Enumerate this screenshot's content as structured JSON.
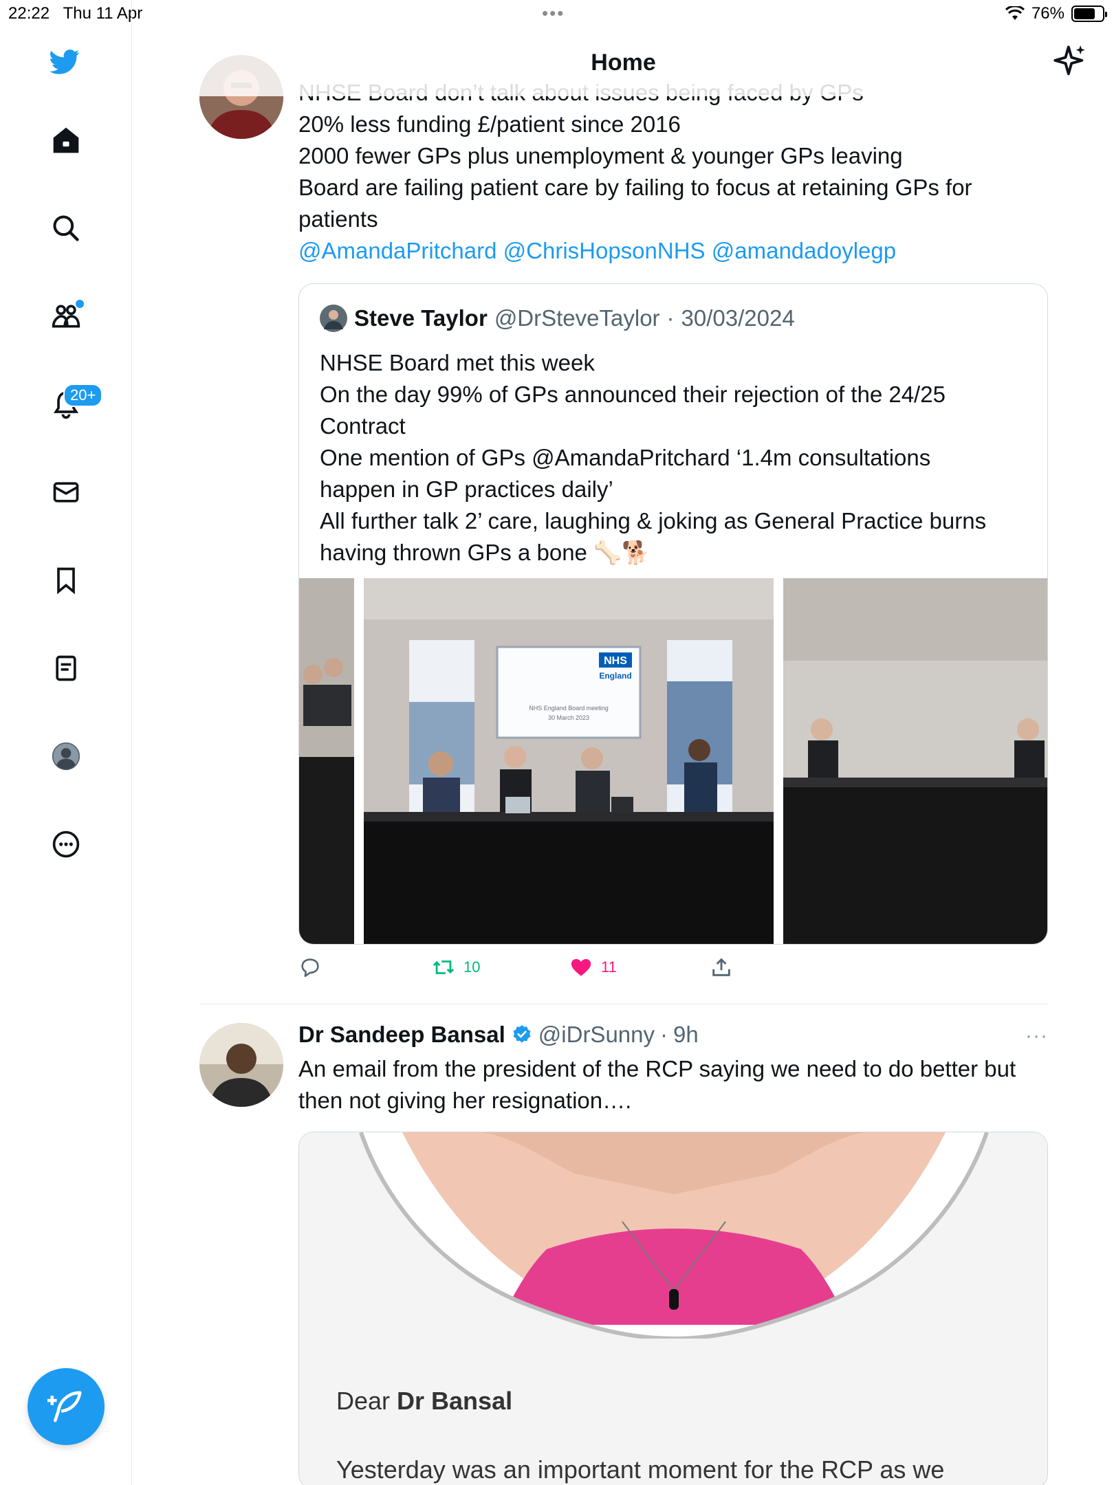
{
  "status_bar": {
    "time": "22:22",
    "date": "Thu 11 Apr",
    "battery": "76%",
    "battery_level": 0.76
  },
  "header": {
    "title": "Home"
  },
  "sidebar": {
    "notifications_badge": "20+",
    "items": [
      "twitter-logo",
      "home",
      "explore",
      "communities",
      "notifications",
      "messages",
      "bookmarks",
      "lists",
      "profile",
      "more"
    ]
  },
  "tweet1": {
    "lines": [
      "NHSE Board don’t talk about issues being faced by GPs",
      "20% less funding £/patient since 2016",
      "2000 fewer GPs plus unemployment & younger GPs leaving",
      "Board are failing patient care by failing to focus at retaining GPs for",
      "patients"
    ],
    "mentions": [
      "@AmandaPritchard",
      "@ChrisHopsonNHS",
      "@amandadoylegp"
    ],
    "quote": {
      "name": "Steve Taylor",
      "handle": "@DrSteveTaylor",
      "sep": "·",
      "date": "30/03/2024",
      "lines": [
        "NHSE Board met this week",
        "On the day 99% of GPs announced their rejection of the 24/25",
        "Contract",
        "One mention of GPs @AmandaPritchard ‘1.4m consultations",
        "happen in GP practices daily’",
        "All further talk 2’ care, laughing & joking as General Practice burns",
        "having thrown GPs a bone 🦴🐕"
      ],
      "image_text": {
        "logo": "NHS",
        "logo_sub": "England",
        "screen_line1": "NHS England Board meeting",
        "screen_line2": "30 March 2023"
      }
    },
    "retweets": "10",
    "likes": "11"
  },
  "tweet2": {
    "name": "Dr Sandeep Bansal",
    "handle": "@iDrSunny",
    "sep": "·",
    "time": "9h",
    "more": "···",
    "lines": [
      "An email from the president of the RCP saying we need to do better but",
      "then not giving her resignation…."
    ],
    "card": {
      "dear": "Dear ",
      "dear_name": "Dr Bansal",
      "line": "Yesterday was an important moment for the RCP as we"
    }
  },
  "colors": {
    "accent": "#1d9bf0",
    "retweet": "#00ba7c",
    "like": "#f91880"
  }
}
